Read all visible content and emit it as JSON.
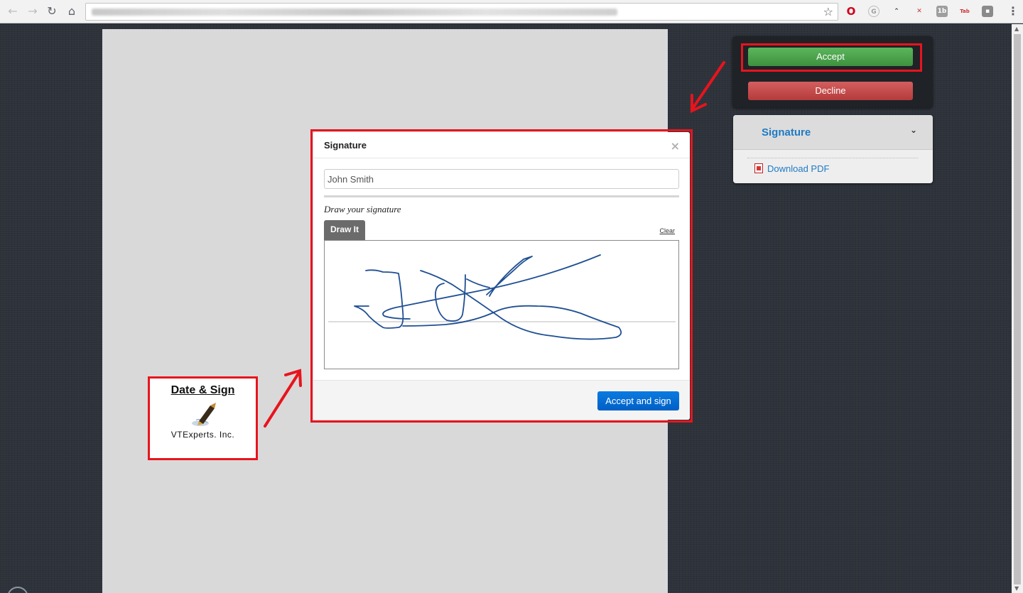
{
  "modal": {
    "title": "Signature",
    "name_value": "John Smith",
    "draw_label": "Draw your signature",
    "draw_tab": "Draw It",
    "clear_label": "Clear",
    "submit_label": "Accept and sign"
  },
  "actions": {
    "accept_label": "Accept",
    "decline_label": "Decline"
  },
  "side_panel": {
    "title": "Signature",
    "download_label": "Download PDF"
  },
  "document": {
    "date_sign_label": "Date & Sign",
    "company": "VTExperts. Inc."
  },
  "colors": {
    "accept": "#4aa34a",
    "decline": "#c84a4a",
    "primary": "#0a6fd8",
    "highlight": "#e8141d",
    "link": "#1f7ac4"
  }
}
